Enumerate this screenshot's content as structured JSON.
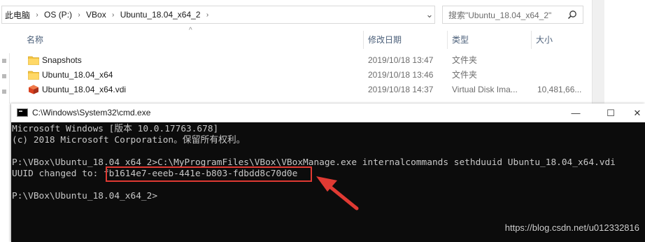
{
  "explorer": {
    "breadcrumb": [
      {
        "label": "此电脑"
      },
      {
        "label": "OS (P:)"
      },
      {
        "label": "VBox"
      },
      {
        "label": "Ubuntu_18.04_x64_2"
      }
    ],
    "search_placeholder": "搜索\"Ubuntu_18.04_x64_2\"",
    "columns": {
      "name": "名称",
      "date": "修改日期",
      "type": "类型",
      "size": "大小"
    },
    "files": [
      {
        "name": "Snapshots",
        "date": "2019/10/18 13:47",
        "type": "文件夹",
        "size": "",
        "icon": "folder-icon"
      },
      {
        "name": "Ubuntu_18.04_x64",
        "date": "2019/10/18 13:46",
        "type": "文件夹",
        "size": "",
        "icon": "folder-icon"
      },
      {
        "name": "Ubuntu_18.04_x64.vdi",
        "date": "2019/10/18 14:37",
        "type": "Virtual Disk Ima...",
        "size": "10,481,66...",
        "icon": "vdi-file-icon"
      }
    ]
  },
  "cmd": {
    "title": "C:\\Windows\\System32\\cmd.exe",
    "lines": [
      "Microsoft Windows [版本 10.0.17763.678]",
      "(c) 2018 Microsoft Corporation。保留所有权利。",
      "",
      "P:\\VBox\\Ubuntu_18.04_x64_2>C:\\MyProgramFiles\\VBox\\VBoxManage.exe internalcommands sethduuid Ubuntu_18.04_x64.vdi",
      "UUID changed to: fb1614e7-eeeb-441e-b803-fdbdd8c70d0e",
      "",
      "P:\\VBox\\Ubuntu_18.04_x64_2>"
    ],
    "buttons": {
      "minimize": "—",
      "maximize": "☐",
      "close": "✕"
    }
  },
  "watermark": "https://blog.csdn.net/u012332816",
  "colors": {
    "highlight": "#e03a33",
    "console_bg": "#0c0c0c",
    "console_text": "#c8c8c8",
    "folder": "#f4c542"
  }
}
